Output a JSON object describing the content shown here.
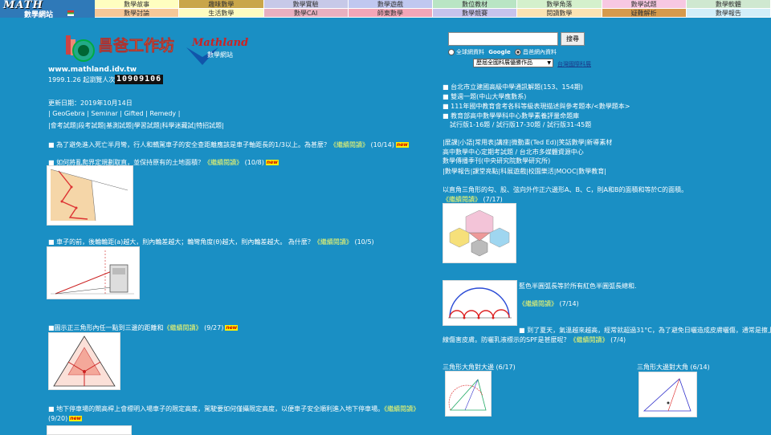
{
  "site": {
    "logo_math": "MATH",
    "logo_sub": "數學網站",
    "url": "www.mathland.idv.tw",
    "since": "1999.1.26 起瀏覽人次",
    "counter": "10909106",
    "logo_title": "昌爸工作坊",
    "logo_brand": "Mathland",
    "logo_brand_sub": "數學網站"
  },
  "nav": [
    {
      "label": "數學故事",
      "color": "#fffec0"
    },
    {
      "label": "趣味數學",
      "color": "#c9a64a"
    },
    {
      "label": "數學實驗",
      "color": "#c7c9e8"
    },
    {
      "label": "數學遊戲",
      "color": "#c0c8f0"
    },
    {
      "label": "數位教材",
      "color": "#b9e5c4"
    },
    {
      "label": "數學角落",
      "color": "#d4f0cc"
    },
    {
      "label": "數學試題",
      "color": "#f7c8e2"
    },
    {
      "label": "數學軟體",
      "color": "#cfe8d0"
    },
    {
      "label": "數學討論",
      "color": "#f6c898"
    },
    {
      "label": "生活數學",
      "color": "#fefcc0"
    },
    {
      "label": "數學CAI",
      "color": "#e8b0c0"
    },
    {
      "label": "師東數學",
      "color": "#f2a6b8"
    },
    {
      "label": "數學競賽",
      "color": "#c7c3ec"
    },
    {
      "label": "閱讀數學",
      "color": "#fbe3b3"
    },
    {
      "label": "疑難解析",
      "color": "#d69a4c"
    },
    {
      "label": "數學報告",
      "color": "#d2eef9"
    }
  ],
  "left": {
    "updated": "更新日期：2019年10月14日",
    "links1": "| GeoGebra | Seminar | Gifted | Remedy |",
    "links2": "|會考試題|段考試題|基測試題|學習試題|科學迷藏試|特招試題|",
    "items": [
      {
        "text": "■ 為了避免進入死亡半月彎，行人和轎駕車子的安全查距離應該是車子軸距長的1/3以上。為甚麼？",
        "more": "《繼續閱讀》",
        "date": "(10/14)"
      },
      {
        "text": "■ 如何將亂爬界定規劃取直，並保持原有的土地面積？",
        "more": "《繼續閱讀》",
        "date": "(10/8)"
      },
      {
        "text": "■ 車子的前，後輪輪距(a)越大，則內輪差越大；輪彎角度(θ)越大，則內輪差越大。  為什麼？",
        "more": "《繼續閱讀》",
        "date": "(10/5)"
      },
      {
        "text": "■圖示正三角形內任一點到三邊的距離和",
        "more": "《繼續閱讀》",
        "date": "(9/27)"
      },
      {
        "text": "■ 地下停車場的閘高桿上會標明入場車子的限定高度，駕駛要如何僅攝限定高度，以便車子安全順利進入地下停車場。",
        "more": "《繼續閱讀》",
        "date": "(9/20)"
      }
    ]
  },
  "right": {
    "search_button": "搜尋",
    "radio1": "全球網資料",
    "radio2": "昌爸網內資料",
    "google": "Google",
    "select_value": "歷屆全國科展優勝作品",
    "select_link": "台灣國際科展",
    "news": [
      "■ 台北市立建國高級中學通訊解題(153、154期)",
      "■ 雙週一題(中山大學應數系)",
      "■ 111年國中教育會考各科等級表現描述與參考題本/<數學題本>",
      "■ 教育部高中數學學科中心數學素養評量命題庫"
    ],
    "news_sub": "試行版1-16題  /  試行版17-30題  /  試行版31-45題",
    "resources1": "|麼課|小語|常用表|講座|微動畫(Ted Ed)|笑話數學|新導素材",
    "resources2": "高中數學中心定期考試題 / 台北市多媒體資源中心",
    "resources3": "數學傳播季刊(中央研究院數學研究所)",
    "resources4": "|數學報告|課堂亮點|科展遊戲|校園樂活|MOOC|數學教育|",
    "triangle_text": "以直角三角形的勾、股、弦向外作正六邊形A、B、C，則A和B的面積和等於C的面積。",
    "triangle_more": "《繼續閱讀》",
    "triangle_date": "(7/17)",
    "semi_text": "藍色半圓弧長等於所有紅色半圓弧長總和.",
    "semi_more": "《繼續閱讀》",
    "semi_date": "(7/14)",
    "summer_text": "■ 到了夏天，氣溫越來越高，經常就超過31°C，為了避免日曬造成皮膚曬傷，通常是擦上防",
    "summer_text2": "線傷害皮膚。防曬乳液標示的SPF是甚麼呢？",
    "summer_more": "《繼續閱讀》",
    "summer_date": "(7/4)",
    "tri1": "三角形大角對大邊 (6/17)",
    "tri2": "三角形大邊對大角 (6/14)"
  }
}
